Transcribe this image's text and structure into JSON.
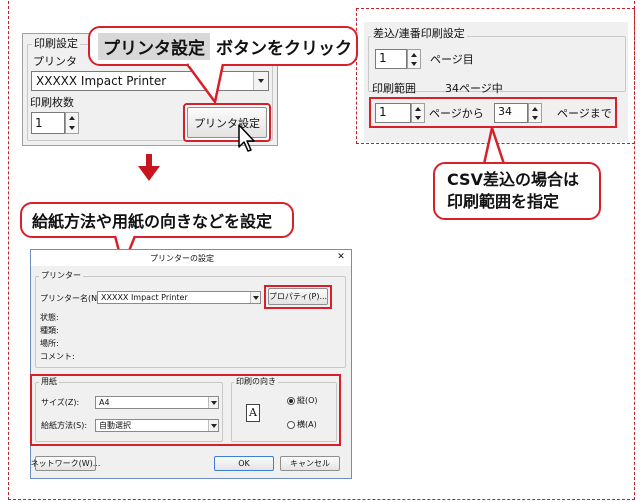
{
  "callouts": {
    "printer_settings_button": "プリンタ設定",
    "printer_settings_suffix": "ボタンをクリック",
    "paper_settings": "給紙方法や用紙の向きなどを設定",
    "csv_range_line1": "CSV差込の場合は",
    "csv_range_line2": "印刷範囲を指定"
  },
  "print_settings_panel": {
    "group_label": "印刷設定",
    "printer_label": "プリンタ",
    "printer_value": "XXXXX Impact Printer",
    "copies_label": "印刷枚数",
    "copies_value": "1",
    "printer_settings_button": "プリンタ設定"
  },
  "merge_panel": {
    "group_label": "差込/連番印刷設定",
    "page_value": "1",
    "page_suffix": "ページ目",
    "range_label": "印刷範囲",
    "total_pages": "34ページ中",
    "from_value": "1",
    "from_suffix": "ページから",
    "to_value": "34",
    "to_suffix": "ページまで"
  },
  "dialog": {
    "title": "プリンターの設定",
    "printer_group": "プリンター",
    "printer_name_label": "プリンター名(N):",
    "printer_name_value": "XXXXX Impact Printer",
    "properties_button": "プロパティ(P)...",
    "status_label": "状態:",
    "type_label": "種類:",
    "where_label": "場所:",
    "comment_label": "コメント:",
    "paper_group": "用紙",
    "size_label": "サイズ(Z):",
    "size_value": "A4",
    "source_label": "給紙方法(S):",
    "source_value": "自動選択",
    "orientation_group": "印刷の向き",
    "orientation_icon_letter": "A",
    "portrait_label": "縦(O)",
    "landscape_label": "横(A)",
    "network_button": "ネットワーク(W)...",
    "ok_button": "OK",
    "cancel_button": "キャンセル",
    "close_symbol": "✕"
  },
  "colors": {
    "accent_red": "#d8202a",
    "arrow_red": "#c8161e",
    "titlebar": "#ffffff",
    "window_bg": "#f0f0f0"
  },
  "icons": [
    "cursor-arrow-icon",
    "down-arrow-icon",
    "dropdown-arrow-icon",
    "spinner-icon",
    "orientation-portrait-icon",
    "close-icon"
  ]
}
